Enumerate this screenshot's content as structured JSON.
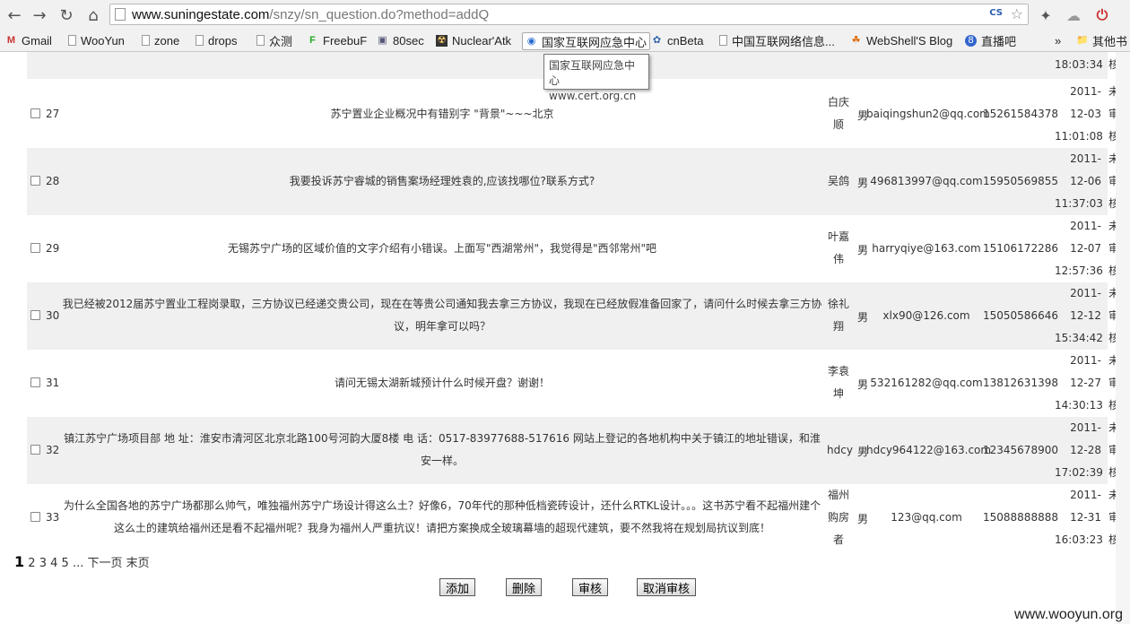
{
  "browser": {
    "url_host": "www.suningestate.com",
    "url_path": "/snzy/sn_question.do?method=addQ",
    "cs_badge": "CS",
    "bookmarks": [
      {
        "label": "Gmail",
        "icon": "gmail-icon"
      },
      {
        "label": "WooYun",
        "icon": "page-icon"
      },
      {
        "label": "zone",
        "icon": "page-icon"
      },
      {
        "label": "drops",
        "icon": "page-icon"
      },
      {
        "label": "众测",
        "icon": "page-icon"
      },
      {
        "label": "FreebuF",
        "icon": "freebuf-icon"
      },
      {
        "label": "80sec",
        "icon": "80sec-icon"
      },
      {
        "label": "Nuclear'Atk",
        "icon": "nuclear-icon"
      },
      {
        "label": "国家互联网应急中心",
        "icon": "cert-icon"
      },
      {
        "label": "cnBeta",
        "icon": "cnbeta-icon"
      },
      {
        "label": "中国互联网络信息...",
        "icon": "page-icon"
      },
      {
        "label": "WebShell'S Blog",
        "icon": "webshell-icon"
      },
      {
        "label": "直播吧",
        "icon": "zhibo8-icon"
      },
      {
        "label": "»",
        "icon": ""
      },
      {
        "label": "其他书",
        "icon": "folder-icon"
      }
    ],
    "tooltip": {
      "line1": "国家互联网应急中心",
      "line2": "www.cert.org.cn"
    }
  },
  "top_partial_row": {
    "time": "18:03:34",
    "status": "核"
  },
  "rows": [
    {
      "id": "27",
      "question": "苏宁置业企业概况中有错别字 \"背景\"~~~北京",
      "name": [
        "白庆",
        "顺"
      ],
      "sex": "男",
      "email": "baiqingshun2@qq.com",
      "phone": "15261584378",
      "date": [
        "2011-",
        "12-03",
        "11:01:08"
      ],
      "status": [
        "未",
        "审",
        "核"
      ]
    },
    {
      "id": "28",
      "question": "我要投诉苏宁睿城的销售案场经理姓袁的,应该找哪位?联系方式?",
      "name": [
        "吴鸽"
      ],
      "sex": "男",
      "email": "496813997@qq.com",
      "phone": "15950569855",
      "date": [
        "2011-",
        "12-06",
        "11:37:03"
      ],
      "status": [
        "未",
        "审",
        "核"
      ]
    },
    {
      "id": "29",
      "question": "无锡苏宁广场的区域价值的文字介绍有小错误。上面写\"西湖常州\"，我觉得是\"西邻常州\"吧",
      "name": [
        "叶嘉",
        "伟"
      ],
      "sex": "男",
      "email": "harryqiye@163.com",
      "phone": "15106172286",
      "date": [
        "2011-",
        "12-07",
        "12:57:36"
      ],
      "status": [
        "未",
        "审",
        "核"
      ]
    },
    {
      "id": "30",
      "question": "我已经被2012届苏宁置业工程岗录取，三方协议已经递交贵公司，现在在等贵公司通知我去拿三方协议，我现在已经放假准备回家了，请问什么时候去拿三方协议，明年拿可以吗？",
      "name": [
        "徐礼",
        "翔"
      ],
      "sex": "男",
      "email": "xlx90@126.com",
      "phone": "15050586646",
      "date": [
        "2011-",
        "12-12",
        "15:34:42"
      ],
      "status": [
        "未",
        "审",
        "核"
      ]
    },
    {
      "id": "31",
      "question": "请问无锡太湖新城预计什么时候开盘？谢谢！",
      "name": [
        "李袁",
        "坤"
      ],
      "sex": "男",
      "email": "532161282@qq.com",
      "phone": "13812631398",
      "date": [
        "2011-",
        "12-27",
        "14:30:13"
      ],
      "status": [
        "未",
        "审",
        "核"
      ]
    },
    {
      "id": "32",
      "question": "镇江苏宁广场项目部 地 址：淮安市清河区北京北路100号河韵大厦8楼 电 话：0517-83977688-517616 网站上登记的各地机构中关于镇江的地址错误，和淮安一样。",
      "name": [
        "hdcy"
      ],
      "sex": "男",
      "email": "hdcy964122@163.com",
      "phone": "12345678900",
      "date": [
        "2011-",
        "12-28",
        "17:02:39"
      ],
      "status": [
        "未",
        "审",
        "核"
      ]
    },
    {
      "id": "33",
      "question": "为什么全国各地的苏宁广场都那么帅气，唯独福州苏宁广场设计得这么土？好像6，70年代的那种低档瓷砖设计，还什么RTKL设计。。。这书苏宁看不起福州建个这么土的建筑给福州还是看不起福州呢？我身为福州人严重抗议！请把方案换成全玻璃幕墙的超现代建筑，要不然我将在规划局抗议到底！",
      "name": [
        "福州",
        "购房",
        "者"
      ],
      "sex": "男",
      "email": "123@qq.com",
      "phone": "15088888888",
      "date": [
        "2011-",
        "12-31",
        "16:03:23"
      ],
      "status": [
        "未",
        "审",
        "核"
      ]
    }
  ],
  "pager": {
    "current": "1",
    "pages": [
      "2",
      "3",
      "4",
      "5"
    ],
    "ellipsis": "...",
    "next": "下一页",
    "last": "末页"
  },
  "actions": {
    "add": "添加",
    "delete": "删除",
    "review": "审核",
    "cancel_review": "取消审核"
  },
  "watermark": "www.wooyun.org"
}
